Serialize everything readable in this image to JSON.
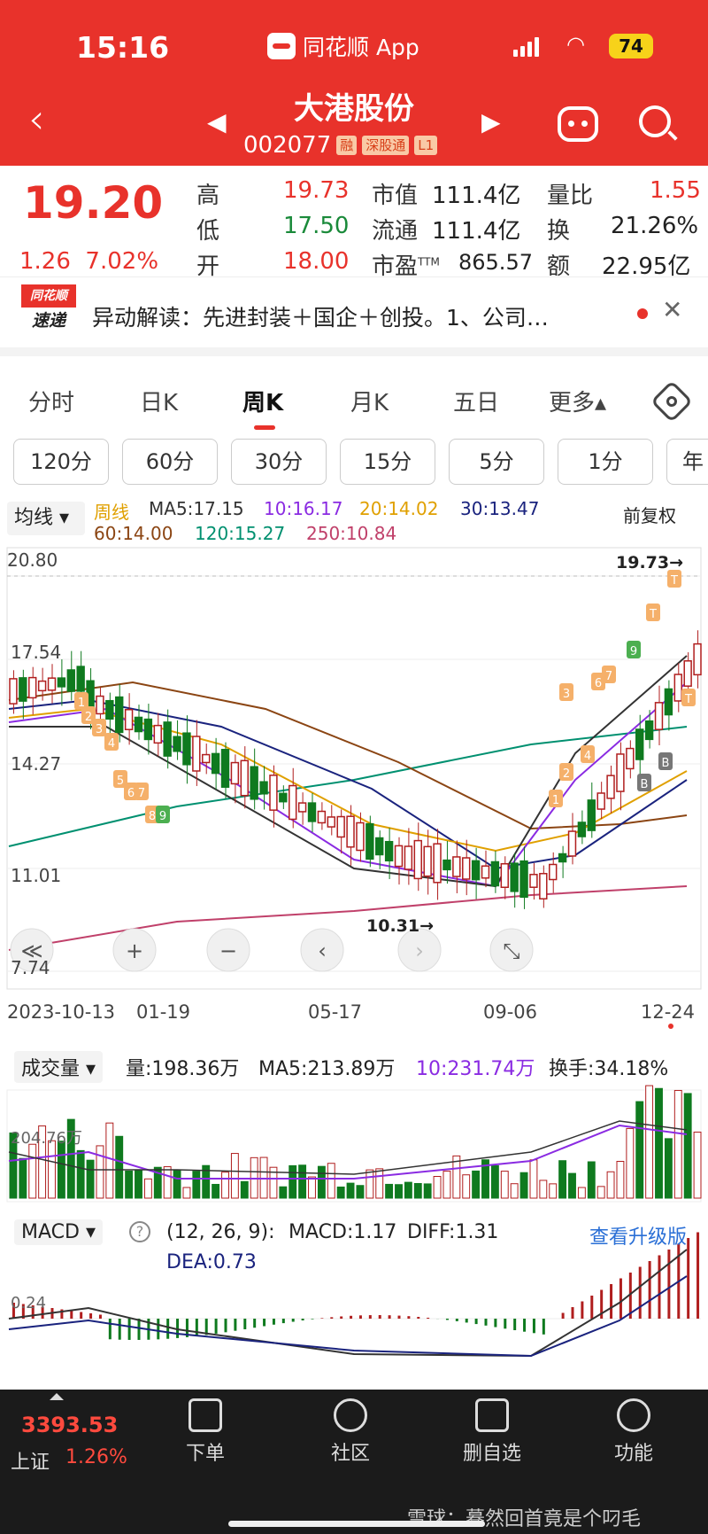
{
  "status": {
    "time": "15:16",
    "app": "同花顺 App",
    "battery": "74"
  },
  "header": {
    "name": "大港股份",
    "code": "002077",
    "tags": [
      "融",
      "深股通",
      "L1"
    ]
  },
  "quote": {
    "price": "19.20",
    "change": "1.26",
    "pct": "7.02%",
    "high_l": "高",
    "high": "19.73",
    "low_l": "低",
    "low": "17.50",
    "open_l": "开",
    "open": "18.00",
    "mcap_l": "市值",
    "mcap": "111.4亿",
    "float_l": "流通",
    "float": "111.4亿",
    "pe_l": "市盈",
    "pe_sup": "TTM",
    "pe": "865.57",
    "vr_l": "量比",
    "vr": "1.55",
    "to_l": "换",
    "to": "21.26%",
    "amt_l": "额",
    "amt": "22.95亿"
  },
  "news": {
    "logo_top": "同花顺",
    "logo_bottom": "速递",
    "text": "异动解读：先进封装＋国企＋创投。1、公司…",
    "close": "✕"
  },
  "tabs": [
    "分时",
    "日K",
    "周K",
    "月K",
    "五日",
    "更多▴"
  ],
  "pills": [
    "120分",
    "60分",
    "30分",
    "15分",
    "5分",
    "1分",
    "年"
  ],
  "ma": {
    "sel": "均线 ▾",
    "period": "周线",
    "ma5": "MA5:17.15",
    "ma10": "10:16.17",
    "ma20": "20:14.02",
    "ma30": "30:13.47",
    "ma60": "60:14.00",
    "ma120": "120:15.27",
    "ma250": "250:10.84",
    "adj": "前复权"
  },
  "kchart": {
    "yticks": [
      "20.80",
      "17.54",
      "14.27",
      "11.01",
      "7.74"
    ],
    "xticks": [
      "2023-10-13",
      "01-19",
      "05-17",
      "09-06",
      "12-24"
    ],
    "hi": "19.73→",
    "lo": "10.31→",
    "marks": [
      "1",
      "2",
      "3",
      "4",
      "5",
      "6",
      "7",
      "8",
      "9",
      "T",
      "B"
    ]
  },
  "vol": {
    "sel": "成交量 ▾",
    "v": "量:198.36万",
    "ma5": "MA5:213.89万",
    "ma10": "10:231.74万",
    "hs": "换手:34.18%",
    "ytick": "204.76万"
  },
  "macd": {
    "sel": "MACD ▾",
    "params": "(12, 26, 9):",
    "macd": "MACD:1.17",
    "diff": "DIFF:1.31",
    "upgrade": "查看升级版",
    "dea": "DEA:0.73",
    "ytick": "0.24"
  },
  "bottom": {
    "idx": "3393.53",
    "idxname": "上证",
    "idxpct": "1.26%",
    "items": [
      "下单",
      "社区",
      "删自选",
      "功能"
    ],
    "wm": "雪球：蓦然回首竟是个叼毛"
  },
  "colors": {
    "up": "#b01e1e",
    "down": "#0f7a1f",
    "brand": "#e8322b"
  }
}
